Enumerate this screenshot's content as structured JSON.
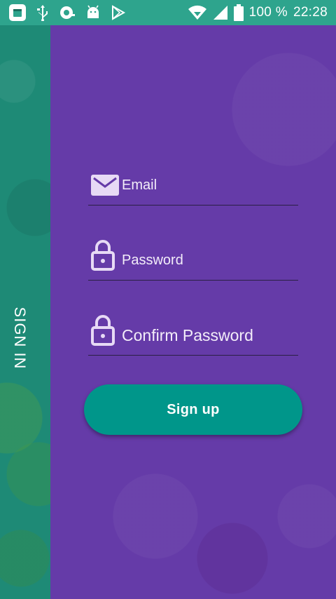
{
  "status_bar": {
    "icons_left": [
      "calendar-icon",
      "usb-icon",
      "android-debug-icon",
      "android-icon",
      "play-store-icon"
    ],
    "icons_right": [
      "wifi-icon",
      "signal-icon",
      "battery-icon"
    ],
    "battery_text": "100 %",
    "time": "22:28"
  },
  "side_panel": {
    "label": "SIGN IN"
  },
  "form": {
    "email_label": "Email",
    "password_label": "Password",
    "confirm_password_label": "Confirm Password",
    "signup_label": "Sign up"
  },
  "colors": {
    "status_bar": "#2ea48d",
    "side_panel": "#1e8a76",
    "main_panel": "#653ba8",
    "button": "#00968a"
  }
}
